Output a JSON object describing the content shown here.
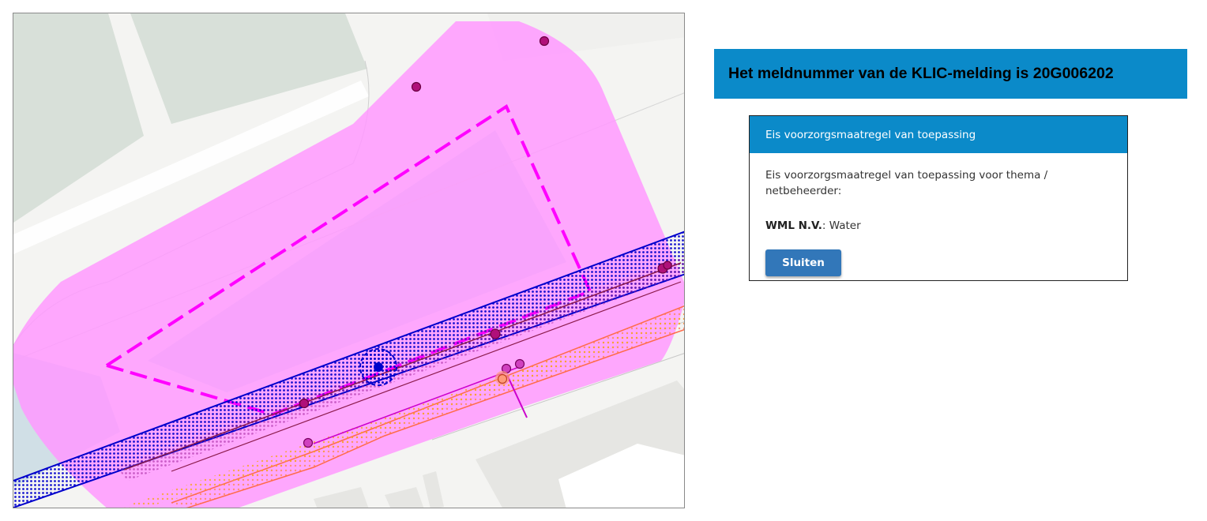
{
  "banner": {
    "title": "Het meldnummer van de KLIC-melding is 20G006202"
  },
  "panel": {
    "header": "Eis voorzorgsmaatregel van toepassing",
    "intro": "Eis voorzorgsmaatregel van toepassing voor thema / netbeheerder:",
    "items": [
      {
        "operator": "WML N.V.",
        "separator": ": ",
        "theme": "Water"
      }
    ],
    "close_label": "Sluiten"
  },
  "map": {
    "colors": {
      "buffer": "#ff99ff",
      "dashed_boundary": "#ff00ff",
      "water_main": "#0000cc",
      "gas_line": "#ff8c69",
      "greenery": "#d9e1da",
      "water_area": "#d0dfe6",
      "buildings": "#e6e6e3"
    },
    "icons": [
      "junction-dot-icon",
      "valve-circle-icon"
    ]
  }
}
